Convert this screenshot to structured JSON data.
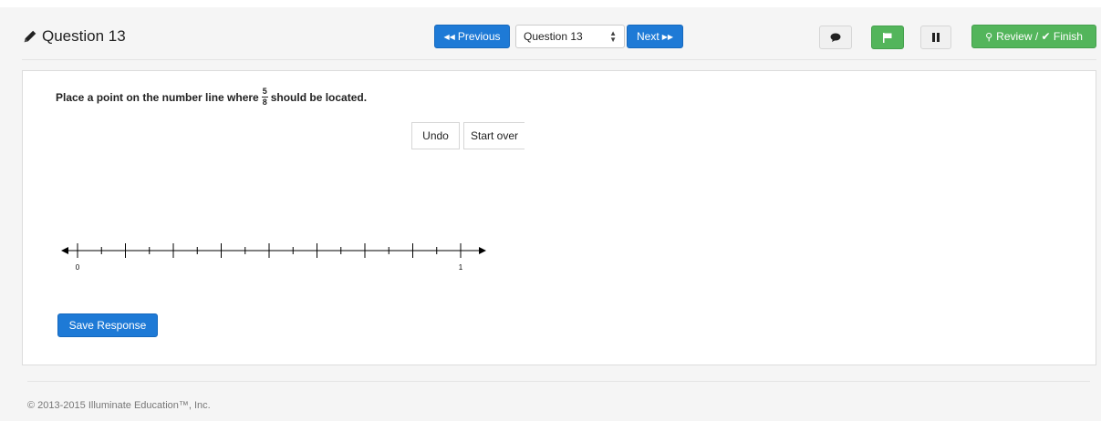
{
  "header": {
    "title": "Question 13",
    "prev_label": "Previous",
    "prev_icon": "◀◀",
    "question_select": "Question 13",
    "next_label": "Next",
    "next_icon": "▶▶",
    "review_label": "Review / ✔ Finish",
    "review_icon": "⚲"
  },
  "question": {
    "prompt_before": "Place a point on the number line where",
    "frac_num": "5",
    "frac_den": "8",
    "prompt_after": "should be located."
  },
  "tools": {
    "undo": "Undo",
    "start_over": "Start over"
  },
  "number_line": {
    "start_label": "0",
    "end_label": "1",
    "major_ticks": 8,
    "minor_per_major": 2
  },
  "save_label": "Save Response",
  "footer": "© 2013-2015 Illuminate Education™, Inc.",
  "colors": {
    "primary": "#1e7ad6",
    "success": "#53b55b"
  }
}
